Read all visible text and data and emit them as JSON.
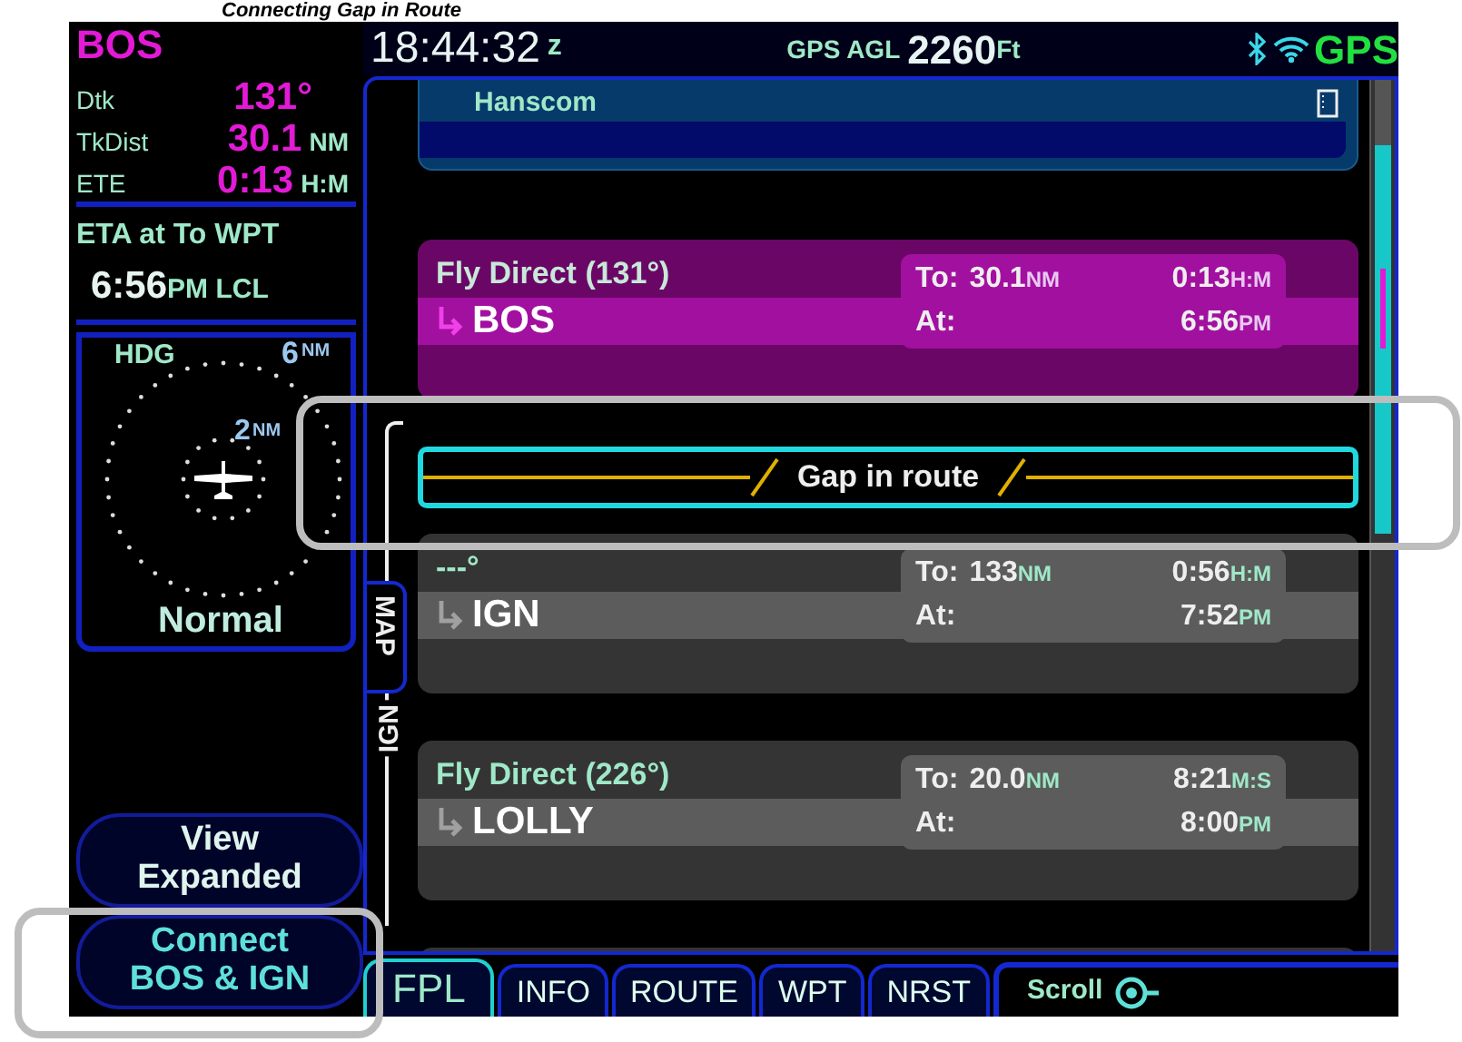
{
  "caption": "Connecting Gap in Route",
  "status_bar": {
    "time": "18:44:32",
    "time_unit": "z",
    "agl_label": "GPS AGL",
    "agl_value": "2260",
    "agl_unit": "Ft",
    "source": "GPS"
  },
  "nav_info": {
    "waypoint": "BOS",
    "fields": [
      {
        "label": "Dtk",
        "value": "131°"
      },
      {
        "label": "TkDist",
        "value": "30.1",
        "unit": "NM"
      },
      {
        "label": "ETE",
        "value": "0:13",
        "unit": "H:M"
      }
    ]
  },
  "eta": {
    "label": "ETA at To WPT",
    "time": "6:56",
    "suffix": "PM LCL"
  },
  "map": {
    "heading_mode": "HDG",
    "outer_range": "6",
    "outer_unit": "NM",
    "inner_range": "2",
    "inner_unit": "NM",
    "mode": "Normal"
  },
  "side_tabs": [
    {
      "kind": "tab",
      "label": "MAP"
    },
    {
      "kind": "label",
      "label": "IGN"
    }
  ],
  "buttons": [
    {
      "label": "View Expanded"
    },
    {
      "label": "Connect BOS & IGN"
    }
  ],
  "flight_plan": [
    {
      "kind": "header",
      "name": "Hanscom"
    },
    {
      "kind": "leg",
      "selected": true,
      "title": "Fly Direct (131°)",
      "waypoint": "BOS",
      "to_label": "To:",
      "distance": "30.1",
      "distance_unit": "NM",
      "time": "0:13",
      "time_unit": "H:M",
      "at_label": "At:",
      "eta": "6:56",
      "eta_unit": "PM"
    },
    {
      "kind": "gap",
      "label": "Gap in route"
    },
    {
      "kind": "leg",
      "selected": false,
      "title": "---°",
      "waypoint": "IGN",
      "to_label": "To:",
      "distance": "133",
      "distance_unit": "NM",
      "time": "0:56",
      "time_unit": "H:M",
      "at_label": "At:",
      "eta": "7:52",
      "eta_unit": "PM"
    },
    {
      "kind": "leg",
      "selected": false,
      "title": "Fly Direct (226°)",
      "waypoint": "LOLLY",
      "to_label": "To:",
      "distance": "20.0",
      "distance_unit": "NM",
      "time": "8:21",
      "time_unit": "M:S",
      "at_label": "At:",
      "eta": "8:00",
      "eta_unit": "PM"
    }
  ],
  "tabs": [
    {
      "label": "FPL",
      "selected": true
    },
    {
      "label": "INFO",
      "selected": false
    },
    {
      "label": "ROUTE",
      "selected": false
    },
    {
      "label": "WPT",
      "selected": false
    },
    {
      "label": "NRST",
      "selected": false
    }
  ],
  "scroll_hint": "Scroll"
}
